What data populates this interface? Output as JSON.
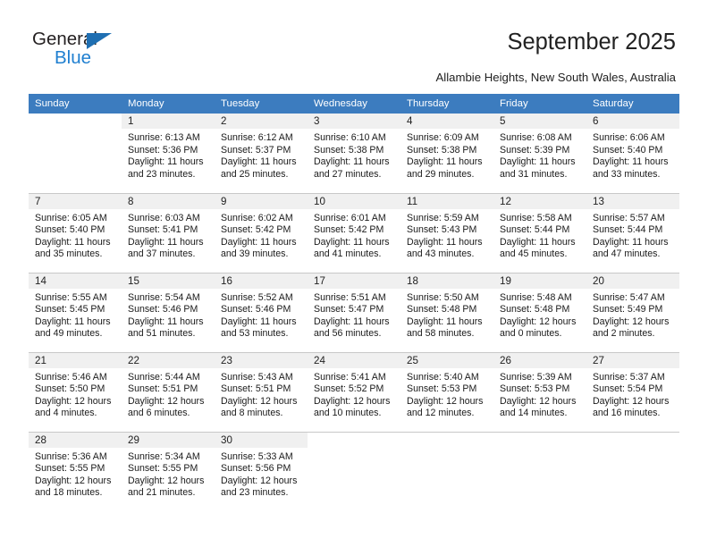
{
  "logo": {
    "word_one": "General",
    "word_two": "Blue",
    "triangle_color": "#1f6fb2",
    "blue_color": "#1f7fd0"
  },
  "header": {
    "title": "September 2025",
    "subtitle": "Allambie Heights, New South Wales, Australia",
    "header_bg": "#3c7cbf",
    "daynum_bg": "#f0f0f0"
  },
  "calendar": {
    "weekday_headers": [
      "Sunday",
      "Monday",
      "Tuesday",
      "Wednesday",
      "Thursday",
      "Friday",
      "Saturday"
    ],
    "weeks": [
      [
        {
          "day": "",
          "sunrise": "",
          "sunset": "",
          "daylight": "",
          "blank": true
        },
        {
          "day": "1",
          "sunrise": "Sunrise: 6:13 AM",
          "sunset": "Sunset: 5:36 PM",
          "daylight": "Daylight: 11 hours and 23 minutes."
        },
        {
          "day": "2",
          "sunrise": "Sunrise: 6:12 AM",
          "sunset": "Sunset: 5:37 PM",
          "daylight": "Daylight: 11 hours and 25 minutes."
        },
        {
          "day": "3",
          "sunrise": "Sunrise: 6:10 AM",
          "sunset": "Sunset: 5:38 PM",
          "daylight": "Daylight: 11 hours and 27 minutes."
        },
        {
          "day": "4",
          "sunrise": "Sunrise: 6:09 AM",
          "sunset": "Sunset: 5:38 PM",
          "daylight": "Daylight: 11 hours and 29 minutes."
        },
        {
          "day": "5",
          "sunrise": "Sunrise: 6:08 AM",
          "sunset": "Sunset: 5:39 PM",
          "daylight": "Daylight: 11 hours and 31 minutes."
        },
        {
          "day": "6",
          "sunrise": "Sunrise: 6:06 AM",
          "sunset": "Sunset: 5:40 PM",
          "daylight": "Daylight: 11 hours and 33 minutes."
        }
      ],
      [
        {
          "day": "7",
          "sunrise": "Sunrise: 6:05 AM",
          "sunset": "Sunset: 5:40 PM",
          "daylight": "Daylight: 11 hours and 35 minutes."
        },
        {
          "day": "8",
          "sunrise": "Sunrise: 6:03 AM",
          "sunset": "Sunset: 5:41 PM",
          "daylight": "Daylight: 11 hours and 37 minutes."
        },
        {
          "day": "9",
          "sunrise": "Sunrise: 6:02 AM",
          "sunset": "Sunset: 5:42 PM",
          "daylight": "Daylight: 11 hours and 39 minutes."
        },
        {
          "day": "10",
          "sunrise": "Sunrise: 6:01 AM",
          "sunset": "Sunset: 5:42 PM",
          "daylight": "Daylight: 11 hours and 41 minutes."
        },
        {
          "day": "11",
          "sunrise": "Sunrise: 5:59 AM",
          "sunset": "Sunset: 5:43 PM",
          "daylight": "Daylight: 11 hours and 43 minutes."
        },
        {
          "day": "12",
          "sunrise": "Sunrise: 5:58 AM",
          "sunset": "Sunset: 5:44 PM",
          "daylight": "Daylight: 11 hours and 45 minutes."
        },
        {
          "day": "13",
          "sunrise": "Sunrise: 5:57 AM",
          "sunset": "Sunset: 5:44 PM",
          "daylight": "Daylight: 11 hours and 47 minutes."
        }
      ],
      [
        {
          "day": "14",
          "sunrise": "Sunrise: 5:55 AM",
          "sunset": "Sunset: 5:45 PM",
          "daylight": "Daylight: 11 hours and 49 minutes."
        },
        {
          "day": "15",
          "sunrise": "Sunrise: 5:54 AM",
          "sunset": "Sunset: 5:46 PM",
          "daylight": "Daylight: 11 hours and 51 minutes."
        },
        {
          "day": "16",
          "sunrise": "Sunrise: 5:52 AM",
          "sunset": "Sunset: 5:46 PM",
          "daylight": "Daylight: 11 hours and 53 minutes."
        },
        {
          "day": "17",
          "sunrise": "Sunrise: 5:51 AM",
          "sunset": "Sunset: 5:47 PM",
          "daylight": "Daylight: 11 hours and 56 minutes."
        },
        {
          "day": "18",
          "sunrise": "Sunrise: 5:50 AM",
          "sunset": "Sunset: 5:48 PM",
          "daylight": "Daylight: 11 hours and 58 minutes."
        },
        {
          "day": "19",
          "sunrise": "Sunrise: 5:48 AM",
          "sunset": "Sunset: 5:48 PM",
          "daylight": "Daylight: 12 hours and 0 minutes."
        },
        {
          "day": "20",
          "sunrise": "Sunrise: 5:47 AM",
          "sunset": "Sunset: 5:49 PM",
          "daylight": "Daylight: 12 hours and 2 minutes."
        }
      ],
      [
        {
          "day": "21",
          "sunrise": "Sunrise: 5:46 AM",
          "sunset": "Sunset: 5:50 PM",
          "daylight": "Daylight: 12 hours and 4 minutes."
        },
        {
          "day": "22",
          "sunrise": "Sunrise: 5:44 AM",
          "sunset": "Sunset: 5:51 PM",
          "daylight": "Daylight: 12 hours and 6 minutes."
        },
        {
          "day": "23",
          "sunrise": "Sunrise: 5:43 AM",
          "sunset": "Sunset: 5:51 PM",
          "daylight": "Daylight: 12 hours and 8 minutes."
        },
        {
          "day": "24",
          "sunrise": "Sunrise: 5:41 AM",
          "sunset": "Sunset: 5:52 PM",
          "daylight": "Daylight: 12 hours and 10 minutes."
        },
        {
          "day": "25",
          "sunrise": "Sunrise: 5:40 AM",
          "sunset": "Sunset: 5:53 PM",
          "daylight": "Daylight: 12 hours and 12 minutes."
        },
        {
          "day": "26",
          "sunrise": "Sunrise: 5:39 AM",
          "sunset": "Sunset: 5:53 PM",
          "daylight": "Daylight: 12 hours and 14 minutes."
        },
        {
          "day": "27",
          "sunrise": "Sunrise: 5:37 AM",
          "sunset": "Sunset: 5:54 PM",
          "daylight": "Daylight: 12 hours and 16 minutes."
        }
      ],
      [
        {
          "day": "28",
          "sunrise": "Sunrise: 5:36 AM",
          "sunset": "Sunset: 5:55 PM",
          "daylight": "Daylight: 12 hours and 18 minutes."
        },
        {
          "day": "29",
          "sunrise": "Sunrise: 5:34 AM",
          "sunset": "Sunset: 5:55 PM",
          "daylight": "Daylight: 12 hours and 21 minutes."
        },
        {
          "day": "30",
          "sunrise": "Sunrise: 5:33 AM",
          "sunset": "Sunset: 5:56 PM",
          "daylight": "Daylight: 12 hours and 23 minutes."
        },
        {
          "day": "",
          "sunrise": "",
          "sunset": "",
          "daylight": "",
          "blank": true
        },
        {
          "day": "",
          "sunrise": "",
          "sunset": "",
          "daylight": "",
          "blank": true
        },
        {
          "day": "",
          "sunrise": "",
          "sunset": "",
          "daylight": "",
          "blank": true
        },
        {
          "day": "",
          "sunrise": "",
          "sunset": "",
          "daylight": "",
          "blank": true
        }
      ]
    ]
  }
}
